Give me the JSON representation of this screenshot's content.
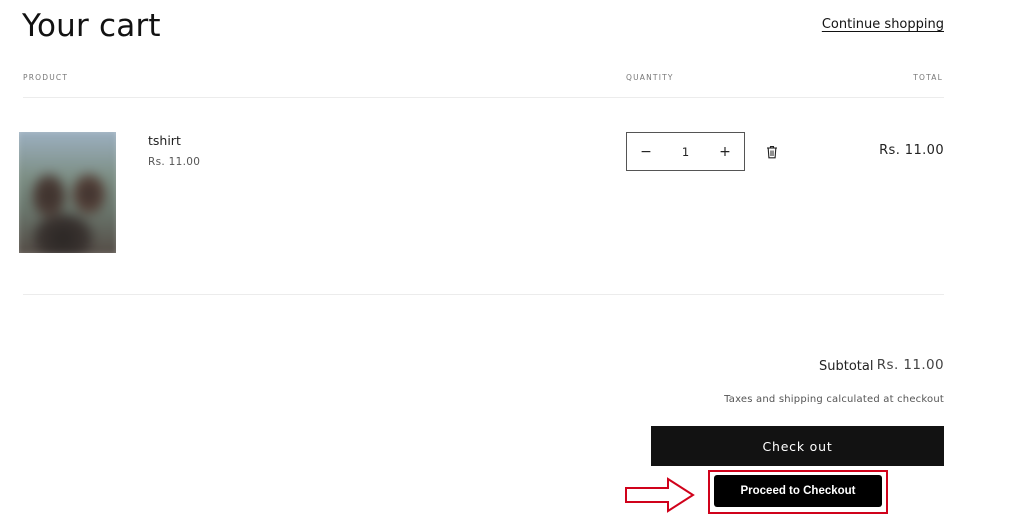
{
  "header": {
    "title": "Your cart",
    "continue_label": "Continue shopping"
  },
  "columns": {
    "product": "PRODUCT",
    "quantity": "QUANTITY",
    "total": "TOTAL"
  },
  "items": [
    {
      "name": "tshirt",
      "price": "Rs. 11.00",
      "quantity": "1",
      "line_total": "Rs. 11.00",
      "image": "product-thumbnail"
    }
  ],
  "quantity_controls": {
    "minus": "−",
    "plus": "+"
  },
  "summary": {
    "subtotal_label": "Subtotal",
    "subtotal_value": "Rs. 11.00",
    "tax_note": "Taxes and shipping calculated at checkout"
  },
  "buttons": {
    "checkout": "Check out",
    "proceed": "Proceed to Checkout"
  },
  "annotation": {
    "highlight_color": "#d0021b",
    "icon": "arrow-right-icon"
  },
  "colors": {
    "text": "#121212",
    "button_bg": "#121212",
    "button_text": "#ffffff"
  }
}
